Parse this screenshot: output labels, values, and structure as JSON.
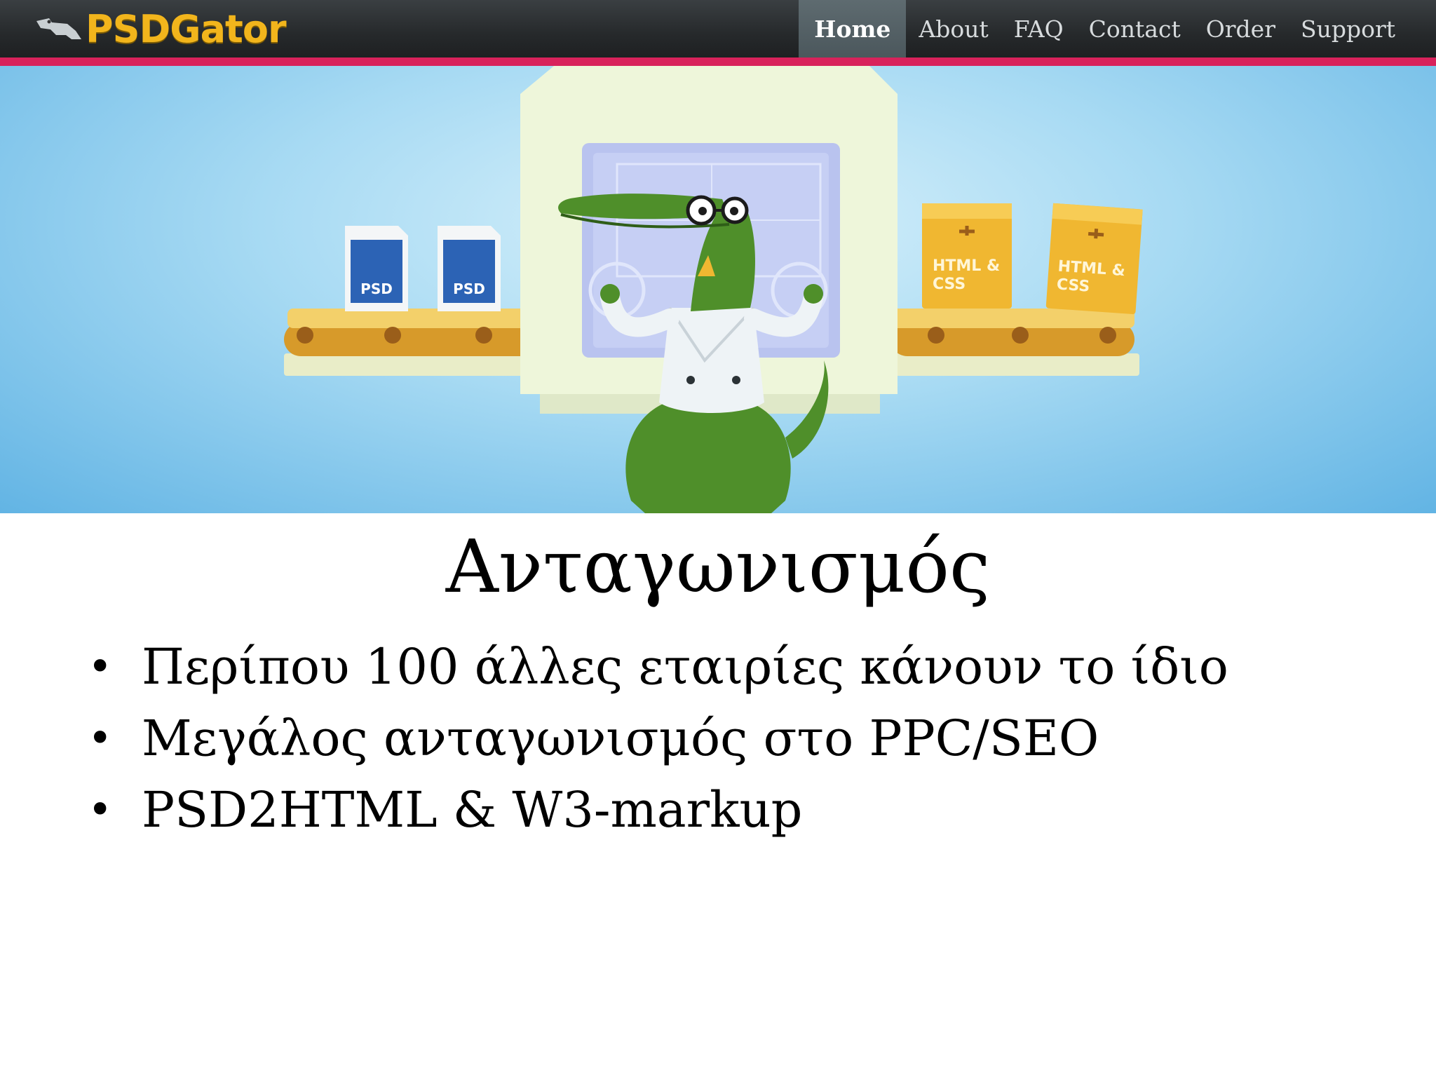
{
  "site": {
    "logo_text": "PSDGator"
  },
  "nav": {
    "items": [
      {
        "label": "Home",
        "active": true
      },
      {
        "label": "About",
        "active": false
      },
      {
        "label": "FAQ",
        "active": false
      },
      {
        "label": "Contact",
        "active": false
      },
      {
        "label": "Order",
        "active": false
      },
      {
        "label": "Support",
        "active": false
      }
    ]
  },
  "hero": {
    "psd_file_label": "PSD",
    "box_label_line1": "HTML &",
    "box_label_line2": "CSS"
  },
  "slide": {
    "title": "Ανταγωνισμός",
    "bullets": [
      "Περίπου 100 άλλες εταιρίες κάνουν το ίδιο",
      "Μεγάλος ανταγωνισμός στο PPC/SEO",
      "PSD2HTML & W3-markup"
    ]
  },
  "colors": {
    "accent_bar": "#d8225b",
    "logo": "#f2b51c",
    "nav_bg": "#26292b",
    "hero_sky": "#a7daf3"
  }
}
